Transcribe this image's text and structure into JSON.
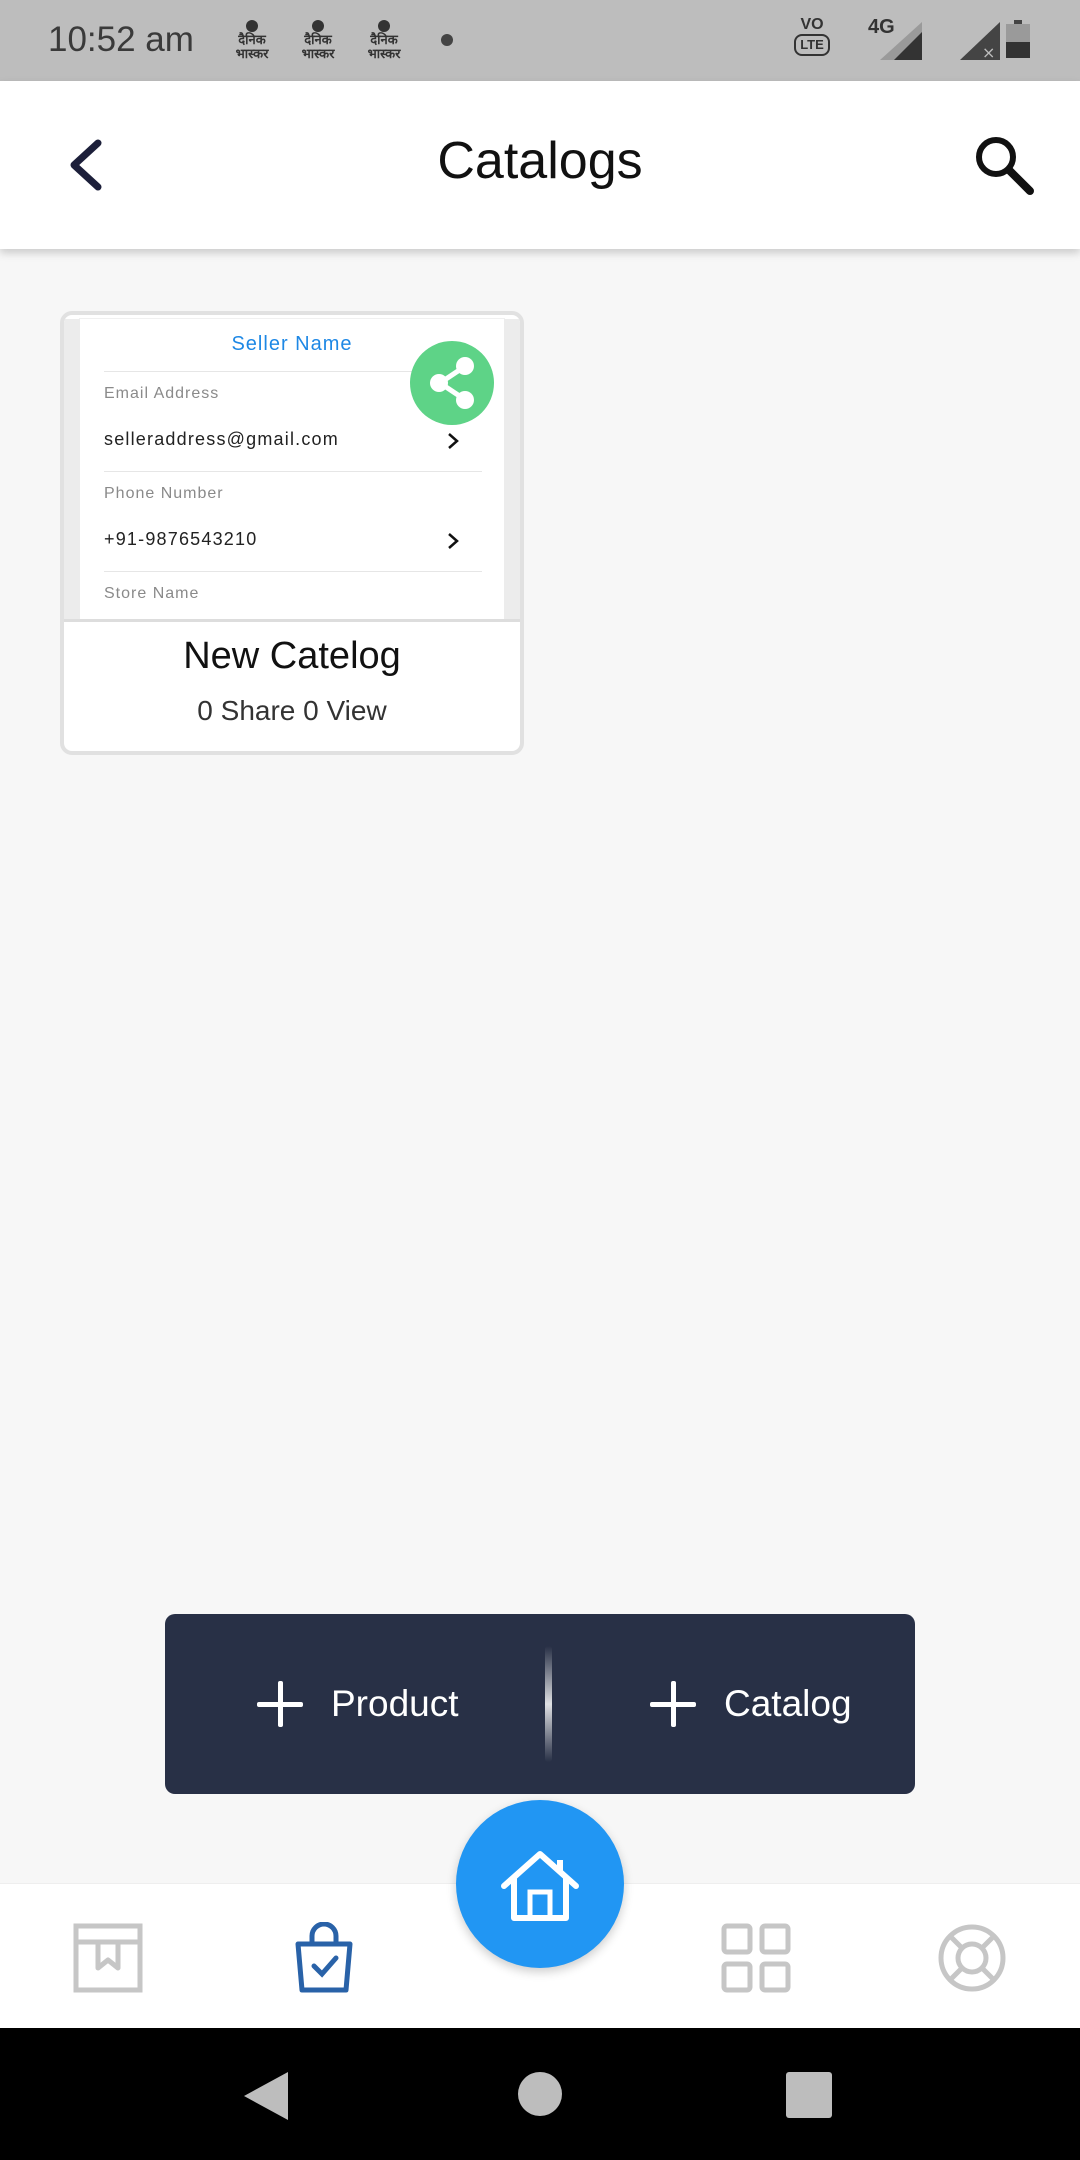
{
  "status_bar": {
    "time": "10:52 am",
    "news_icon_text": "दैनिक भास्कर",
    "volte": "VO",
    "lte": "LTE",
    "network": "4G"
  },
  "app_bar": {
    "title": "Catalogs"
  },
  "catalogs": [
    {
      "preview": {
        "seller_name": "Seller Name",
        "email_label": "Email Address",
        "email_value": "selleraddress@gmail.com",
        "phone_label": "Phone Number",
        "phone_value": "+91-9876543210",
        "store_label": "Store Name"
      },
      "name": "New Catelog",
      "stats": "0 Share 0 View"
    }
  ],
  "actions": {
    "product_label": "Product",
    "catalog_label": "Catalog"
  },
  "colors": {
    "accent_blue": "#2196f3",
    "share_green": "#5ed387",
    "panel_dark": "#283046",
    "seller_blue": "#1e88e5"
  }
}
